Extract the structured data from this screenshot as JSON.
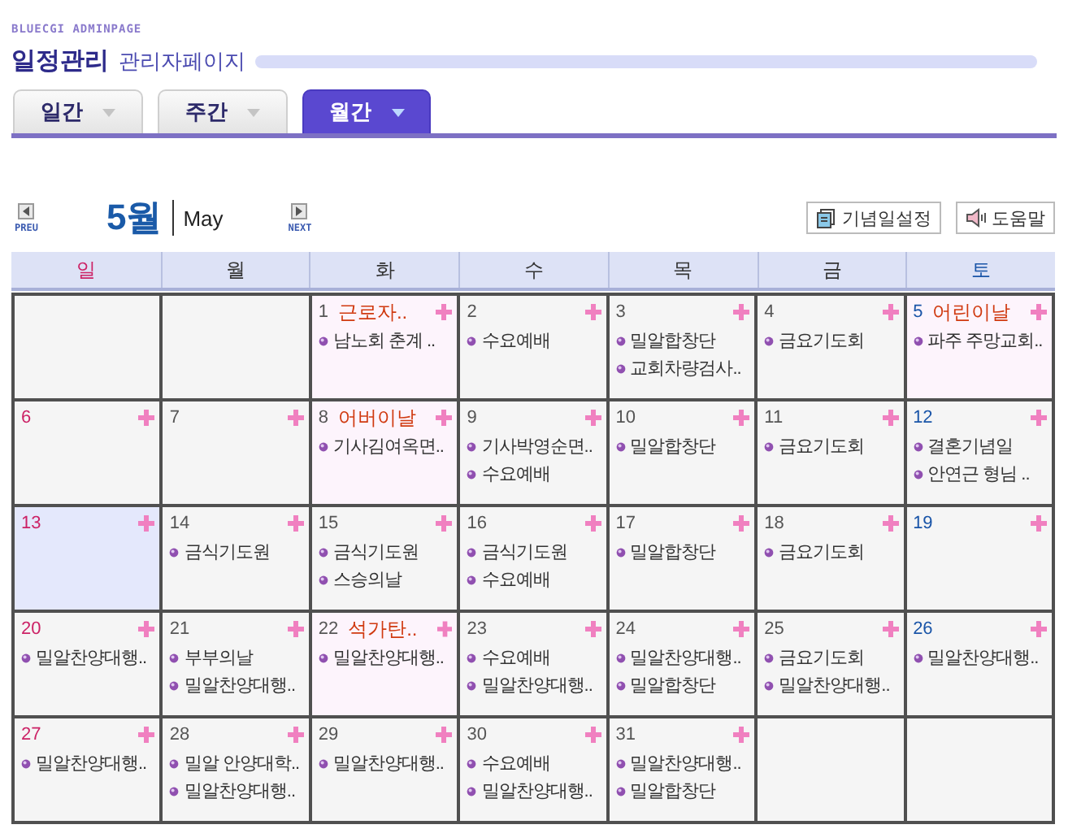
{
  "brand": "BLUECGI ADMINPAGE",
  "title": "일정관리",
  "subtitle": "관리자페이지",
  "tabs": [
    {
      "label": "일간",
      "selected": false
    },
    {
      "label": "주간",
      "selected": false
    },
    {
      "label": "월간",
      "selected": true
    }
  ],
  "nav": {
    "prev": "PREU",
    "month": "5월",
    "month_en": "May",
    "next": "NEXT"
  },
  "buttons": [
    {
      "label": "기념일설정",
      "kind": "calendar"
    },
    {
      "label": "도움말",
      "kind": "help"
    }
  ],
  "weekdays": [
    {
      "label": "일",
      "kind": "sun"
    },
    {
      "label": "월",
      "kind": "weekday"
    },
    {
      "label": "화",
      "kind": "weekday"
    },
    {
      "label": "수",
      "kind": "weekday"
    },
    {
      "label": "목",
      "kind": "weekday"
    },
    {
      "label": "금",
      "kind": "weekday"
    },
    {
      "label": "토",
      "kind": "sat"
    }
  ],
  "weeks": [
    {
      "days": [
        {
          "kind": "empty",
          "today": false
        },
        {
          "kind": "empty",
          "today": false
        },
        {
          "day": "1",
          "kind": "weekday",
          "today": false,
          "holiday": "근로자..",
          "events": [
            "남노회 춘계 .."
          ]
        },
        {
          "day": "2",
          "kind": "weekday",
          "today": false,
          "events": [
            "수요예배"
          ]
        },
        {
          "day": "3",
          "kind": "weekday",
          "today": false,
          "events": [
            "밀알합창단",
            "교회차량검사.."
          ]
        },
        {
          "day": "4",
          "kind": "weekday",
          "today": false,
          "events": [
            "금요기도회"
          ]
        },
        {
          "day": "5",
          "kind": "sat",
          "today": false,
          "holiday": "어린이날",
          "events": [
            "파주 주망교회.."
          ]
        }
      ]
    },
    {
      "days": [
        {
          "day": "6",
          "kind": "sun",
          "today": false
        },
        {
          "day": "7",
          "kind": "weekday",
          "today": false
        },
        {
          "day": "8",
          "kind": "weekday",
          "today": false,
          "holiday": "어버이날",
          "events": [
            "기사김여옥면.."
          ]
        },
        {
          "day": "9",
          "kind": "weekday",
          "today": false,
          "events": [
            "기사박영순면..",
            "수요예배"
          ]
        },
        {
          "day": "10",
          "kind": "weekday",
          "today": false,
          "events": [
            "밀알합창단"
          ]
        },
        {
          "day": "11",
          "kind": "weekday",
          "today": false,
          "events": [
            "금요기도회"
          ]
        },
        {
          "day": "12",
          "kind": "sat",
          "today": false,
          "events": [
            "결혼기념일",
            "안연근 형님 .."
          ]
        }
      ]
    },
    {
      "days": [
        {
          "day": "13",
          "kind": "sun",
          "today": true
        },
        {
          "day": "14",
          "kind": "weekday",
          "today": false,
          "events": [
            "금식기도원"
          ]
        },
        {
          "day": "15",
          "kind": "weekday",
          "today": false,
          "events": [
            "금식기도원",
            "스승의날"
          ]
        },
        {
          "day": "16",
          "kind": "weekday",
          "today": false,
          "events": [
            "금식기도원",
            "수요예배"
          ]
        },
        {
          "day": "17",
          "kind": "weekday",
          "today": false,
          "events": [
            "밀알합창단"
          ]
        },
        {
          "day": "18",
          "kind": "weekday",
          "today": false,
          "events": [
            "금요기도회"
          ]
        },
        {
          "day": "19",
          "kind": "sat",
          "today": false
        }
      ]
    },
    {
      "days": [
        {
          "day": "20",
          "kind": "sun",
          "today": false,
          "events": [
            "밀알찬양대행.."
          ]
        },
        {
          "day": "21",
          "kind": "weekday",
          "today": false,
          "events": [
            "부부의날",
            "밀알찬양대행.."
          ]
        },
        {
          "day": "22",
          "kind": "weekday",
          "today": false,
          "holiday": "석가탄..",
          "events": [
            "밀알찬양대행.."
          ]
        },
        {
          "day": "23",
          "kind": "weekday",
          "today": false,
          "events": [
            "수요예배",
            "밀알찬양대행.."
          ]
        },
        {
          "day": "24",
          "kind": "weekday",
          "today": false,
          "events": [
            "밀알찬양대행..",
            "밀알합창단"
          ]
        },
        {
          "day": "25",
          "kind": "weekday",
          "today": false,
          "events": [
            "금요기도회",
            "밀알찬양대행.."
          ]
        },
        {
          "day": "26",
          "kind": "sat",
          "today": false,
          "events": [
            "밀알찬양대행.."
          ]
        }
      ]
    },
    {
      "days": [
        {
          "day": "27",
          "kind": "sun",
          "today": false,
          "events": [
            "밀알찬양대행.."
          ]
        },
        {
          "day": "28",
          "kind": "weekday",
          "today": false,
          "events": [
            "밀알 안양대학..",
            "밀알찬양대행.."
          ]
        },
        {
          "day": "29",
          "kind": "weekday",
          "today": false,
          "events": [
            "밀알찬양대행.."
          ]
        },
        {
          "day": "30",
          "kind": "weekday",
          "today": false,
          "events": [
            "수요예배",
            "밀알찬양대행.."
          ]
        },
        {
          "day": "31",
          "kind": "weekday",
          "today": false,
          "events": [
            "밀알찬양대행..",
            "밀알합창단"
          ]
        },
        {
          "kind": "empty",
          "today": false
        },
        {
          "kind": "empty",
          "today": false
        }
      ]
    }
  ]
}
